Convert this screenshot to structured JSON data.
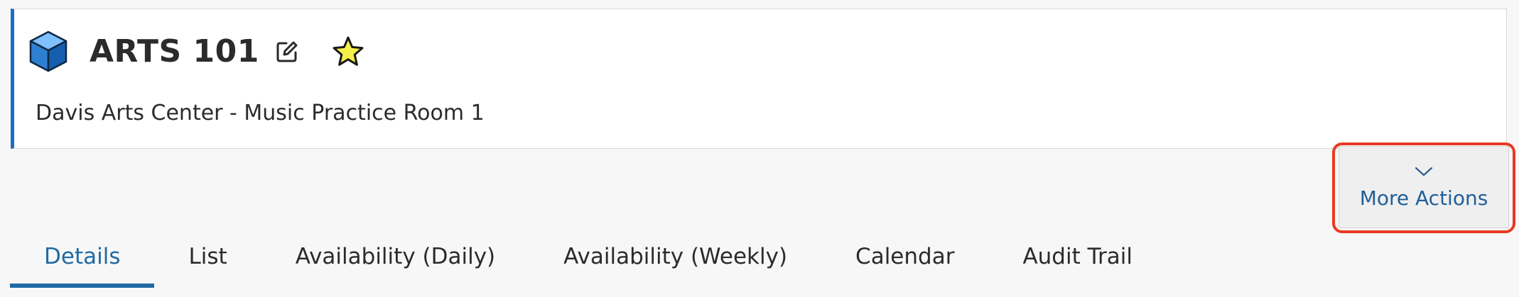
{
  "header": {
    "title": "ARTS 101",
    "subtitle": "Davis Arts Center - Music Practice Room 1",
    "icons": {
      "entity": "cube-icon",
      "edit": "edit-icon",
      "favorite": "star-icon"
    }
  },
  "actions": {
    "more_actions_label": "More Actions",
    "more_actions_icon": "chevron-down-icon"
  },
  "tabs": [
    {
      "label": "Details",
      "active": true
    },
    {
      "label": "List",
      "active": false
    },
    {
      "label": "Availability (Daily)",
      "active": false
    },
    {
      "label": "Availability (Weekly)",
      "active": false
    },
    {
      "label": "Calendar",
      "active": false
    },
    {
      "label": "Audit Trail",
      "active": false
    }
  ],
  "colors": {
    "accent": "#1f6aa5",
    "card_border_accent": "#1b6fc3",
    "highlight": "#e83a24",
    "star": "#f8f04a",
    "cube": "#2f7fd1"
  }
}
